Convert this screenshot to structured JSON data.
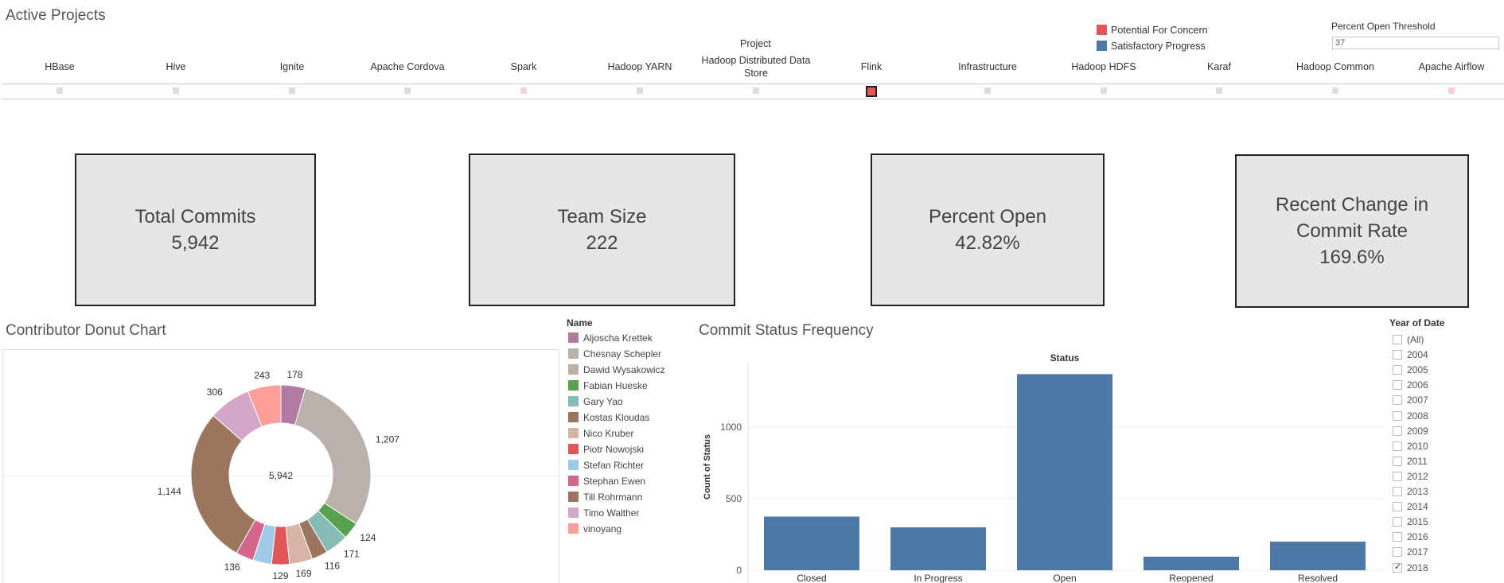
{
  "header": {
    "title": "Active Projects",
    "project_field": "Project"
  },
  "legend_status": {
    "items": [
      {
        "label": "Potential For Concern",
        "color": "#e15759"
      },
      {
        "label": "Satisfactory Progress",
        "color": "#4e79a7"
      }
    ]
  },
  "threshold": {
    "label": "Percent Open Threshold",
    "value": "37"
  },
  "projects": [
    {
      "name": "HBase",
      "status": "normal"
    },
    {
      "name": "Hive",
      "status": "normal"
    },
    {
      "name": "Ignite",
      "status": "normal"
    },
    {
      "name": "Apache Cordova",
      "status": "normal"
    },
    {
      "name": "Spark",
      "status": "concern"
    },
    {
      "name": "Hadoop YARN",
      "status": "normal"
    },
    {
      "name": "Hadoop Distributed Data Store",
      "status": "normal"
    },
    {
      "name": "Flink",
      "status": "selected"
    },
    {
      "name": "Infrastructure",
      "status": "normal"
    },
    {
      "name": "Hadoop HDFS",
      "status": "normal"
    },
    {
      "name": "Karaf",
      "status": "normal"
    },
    {
      "name": "Hadoop Common",
      "status": "normal"
    },
    {
      "name": "Apache Airflow",
      "status": "concern"
    }
  ],
  "kpis": {
    "total_commits": {
      "label": "Total Commits",
      "value": "5,942"
    },
    "team_size": {
      "label": "Team Size",
      "value": "222"
    },
    "percent_open": {
      "label": "Percent Open",
      "value": "42.82%"
    },
    "recent_change": {
      "label_line1": "Recent Change in",
      "label_line2": "Commit Rate",
      "value": "169.6%"
    }
  },
  "donut": {
    "title": "Contributor Donut Chart",
    "center_label": "5,942",
    "legend_title": "Name"
  },
  "bar": {
    "title": "Commit Status Frequency",
    "header": "Status",
    "ylabel": "Count of Status"
  },
  "years": {
    "title": "Year of Date",
    "items": [
      {
        "label": "(All)",
        "checked": false
      },
      {
        "label": "2004",
        "checked": false
      },
      {
        "label": "2005",
        "checked": false
      },
      {
        "label": "2006",
        "checked": false
      },
      {
        "label": "2007",
        "checked": false
      },
      {
        "label": "2008",
        "checked": false
      },
      {
        "label": "2009",
        "checked": false
      },
      {
        "label": "2010",
        "checked": false
      },
      {
        "label": "2011",
        "checked": false
      },
      {
        "label": "2012",
        "checked": false
      },
      {
        "label": "2013",
        "checked": false
      },
      {
        "label": "2014",
        "checked": false
      },
      {
        "label": "2015",
        "checked": false
      },
      {
        "label": "2016",
        "checked": false
      },
      {
        "label": "2017",
        "checked": false
      },
      {
        "label": "2018",
        "checked": true
      }
    ]
  },
  "chart_data": [
    {
      "type": "pie",
      "title": "Contributor Donut Chart",
      "total": 5942,
      "slices": [
        {
          "name": "Aljoscha Krettek",
          "value": 178,
          "color": "#b07aa1",
          "label": "178"
        },
        {
          "name": "Chesnay Schepler",
          "value": 1207,
          "color": "#bab0ac",
          "label": "1,207"
        },
        {
          "name": "Dawid Wysakowicz",
          "value": 0,
          "color": "#bab0ac",
          "label": ""
        },
        {
          "name": "Fabian Hueske",
          "value": 124,
          "color": "#59a14f",
          "label": "124"
        },
        {
          "name": "Gary Yao",
          "value": 171,
          "color": "#86bcb6",
          "label": "171"
        },
        {
          "name": "Kostas Kloudas",
          "value": 116,
          "color": "#9c755f",
          "label": "116"
        },
        {
          "name": "Nico Kruber",
          "value": 169,
          "color": "#d7b5a6",
          "label": "169"
        },
        {
          "name": "Piotr Nowojski",
          "value": 129,
          "color": "#e15759",
          "label": "129"
        },
        {
          "name": "Stefan Richter",
          "value": 136,
          "color": "#a0cbe8",
          "label": ""
        },
        {
          "name": "Stephan Ewen",
          "value": 130,
          "color": "#d4668e",
          "label": "136"
        },
        {
          "name": "Till Rohrmann",
          "value": 1144,
          "color": "#9c755f",
          "label": "1,144"
        },
        {
          "name": "Timo Walther",
          "value": 306,
          "color": "#d4a6c8",
          "label": "306"
        },
        {
          "name": "vinoyang",
          "value": 243,
          "color": "#ff9d9a",
          "label": "243"
        }
      ]
    },
    {
      "type": "bar",
      "title": "Commit Status Frequency",
      "xlabel": "Status",
      "ylabel": "Count of Status",
      "categories": [
        "Closed",
        "In Progress",
        "Open",
        "Reopened",
        "Resolved"
      ],
      "values": [
        375,
        300,
        1370,
        95,
        200
      ],
      "ylim": [
        0,
        1400
      ],
      "yticks": [
        0,
        500,
        1000
      ],
      "color": "#4e79a7"
    }
  ]
}
